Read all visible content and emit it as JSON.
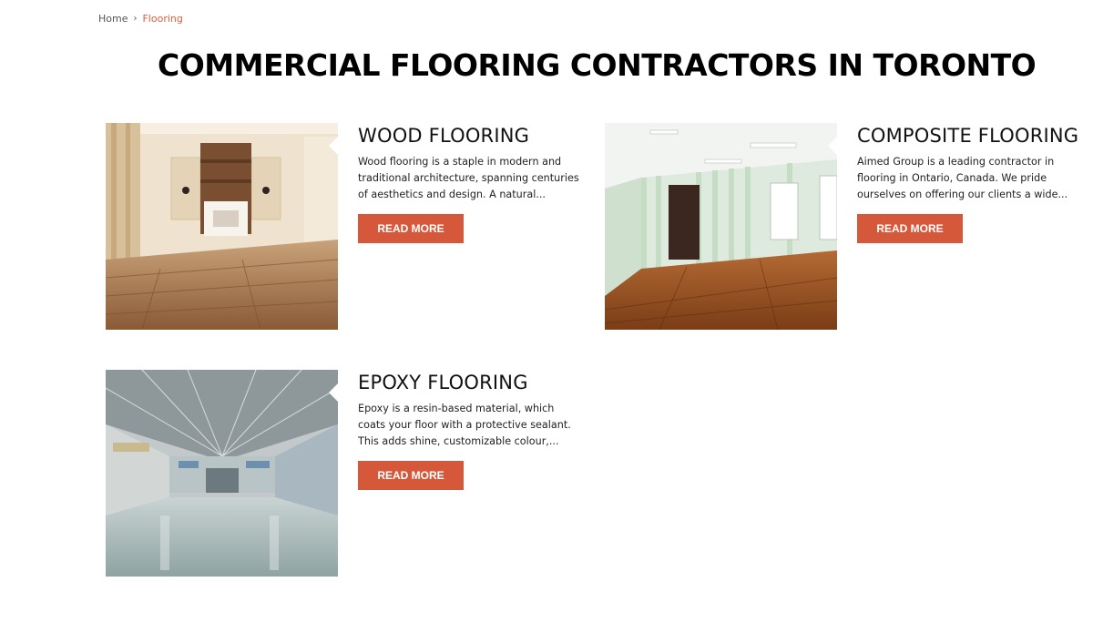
{
  "breadcrumb": {
    "home": "Home",
    "separator": "›",
    "current": "Flooring"
  },
  "page_title": "COMMERCIAL FLOORING CONTRACTORS IN TORONTO",
  "colors": {
    "accent": "#d6583a",
    "breadcrumb_current": "#d9603b"
  },
  "cards": [
    {
      "title": "WOOD FLOORING",
      "excerpt": "  Wood flooring is a staple in modern and traditional architecture, spanning centuries of aesthetics and design. A natural...",
      "button": "READ MORE"
    },
    {
      "title": "COMPOSITE FLOORING",
      "excerpt": "  Aimed Group is a leading contractor in flooring in Ontario, Canada. We pride ourselves on offering our clients a wide...",
      "button": "READ MORE"
    },
    {
      "title": "EPOXY FLOORING",
      "excerpt": "  Epoxy is a resin-based material, which coats your floor with a protective sealant. This adds shine, customizable colour,...",
      "button": "READ MORE"
    }
  ]
}
